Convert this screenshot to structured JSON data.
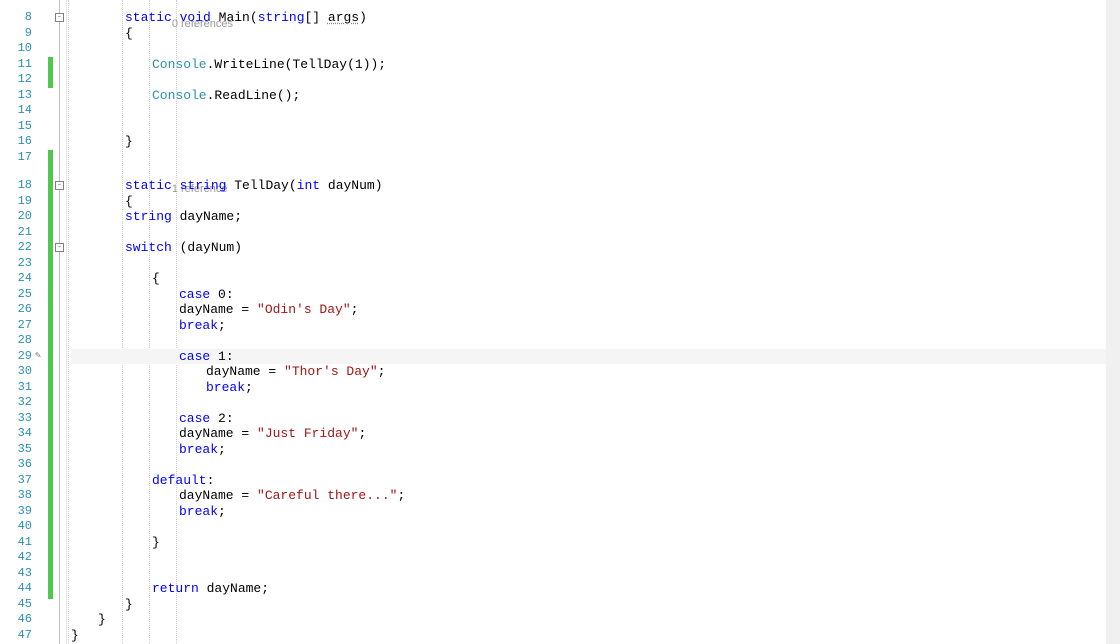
{
  "gutter": {
    "start": 8,
    "end": 47
  },
  "codelens": {
    "main": "0 references",
    "tellday": "1 reference"
  },
  "code": {
    "static": "static",
    "void": "void",
    "string_kw": "string",
    "int_kw": "int",
    "switch_kw": "switch",
    "case_kw": "case",
    "break_kw": "break",
    "default_kw": "default",
    "return_kw": "return",
    "main": "Main",
    "args": "args",
    "console": "Console",
    "writeline": "WriteLine",
    "readline": "ReadLine",
    "tellday": "TellDay",
    "dayNum": "dayNum",
    "dayName": "dayName",
    "str_odin": "\"Odin's Day\"",
    "str_thor": "\"Thor's Day\"",
    "str_friday": "\"Just Friday\"",
    "str_careful": "\"Careful there...\"",
    "n0": "0",
    "n1": "1",
    "n2": "2"
  },
  "change_bars": [
    {
      "from": 11,
      "to": 12
    },
    {
      "from": 17,
      "to": 45
    }
  ],
  "collapse_boxes": [
    8,
    18,
    22
  ],
  "current_line": 29
}
